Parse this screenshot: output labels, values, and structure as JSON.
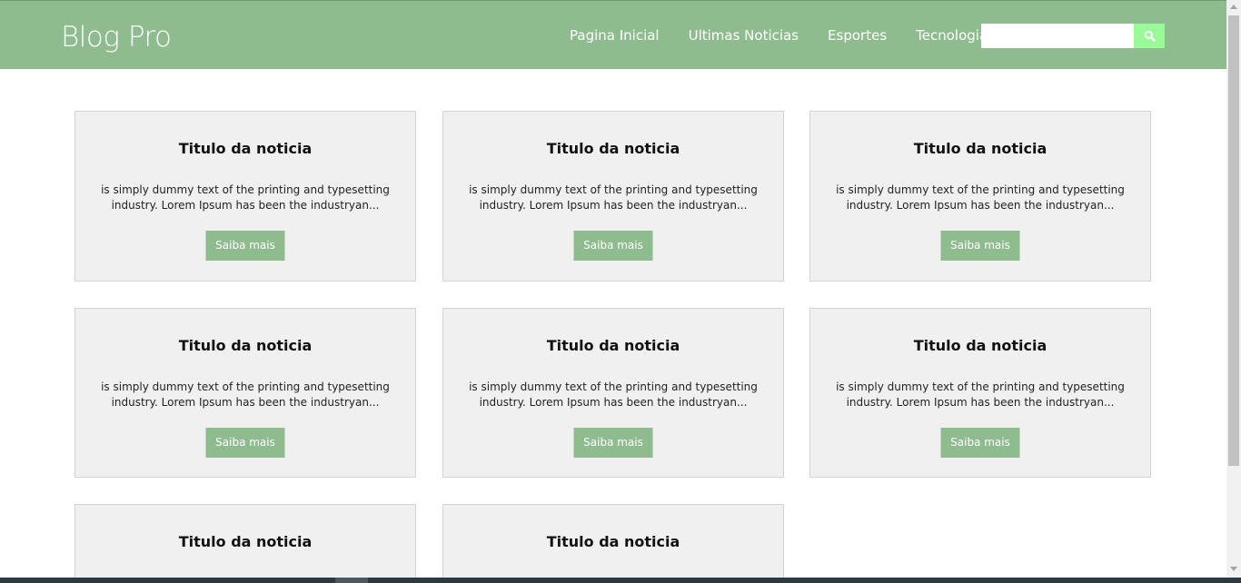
{
  "header": {
    "brand": "Blog Pro",
    "nav": [
      "Pagina Inicial",
      "Ultimas Noticias",
      "Esportes",
      "Tecnologia"
    ],
    "search": {
      "value": "",
      "placeholder": ""
    },
    "search_icon": "search-icon"
  },
  "cards": [
    {
      "title": "Titulo da noticia",
      "text": "is simply dummy text of the printing and typesetting industry. Lorem Ipsum has been the industryan...",
      "button": "Saiba mais"
    },
    {
      "title": "Titulo da noticia",
      "text": "is simply dummy text of the printing and typesetting industry. Lorem Ipsum has been the industryan...",
      "button": "Saiba mais"
    },
    {
      "title": "Titulo da noticia",
      "text": "is simply dummy text of the printing and typesetting industry. Lorem Ipsum has been the industryan...",
      "button": "Saiba mais"
    },
    {
      "title": "Titulo da noticia",
      "text": "is simply dummy text of the printing and typesetting industry. Lorem Ipsum has been the industryan...",
      "button": "Saiba mais"
    },
    {
      "title": "Titulo da noticia",
      "text": "is simply dummy text of the printing and typesetting industry. Lorem Ipsum has been the industryan...",
      "button": "Saiba mais"
    },
    {
      "title": "Titulo da noticia",
      "text": "is simply dummy text of the printing and typesetting industry. Lorem Ipsum has been the industryan...",
      "button": "Saiba mais"
    },
    {
      "title": "Titulo da noticia"
    },
    {
      "title": "Titulo da noticia"
    }
  ],
  "colors": {
    "header_bg": "#8fbc8f",
    "search_button": "#98fb98",
    "card_bg": "#f0f0f0",
    "card_button": "#8fbc8f"
  }
}
